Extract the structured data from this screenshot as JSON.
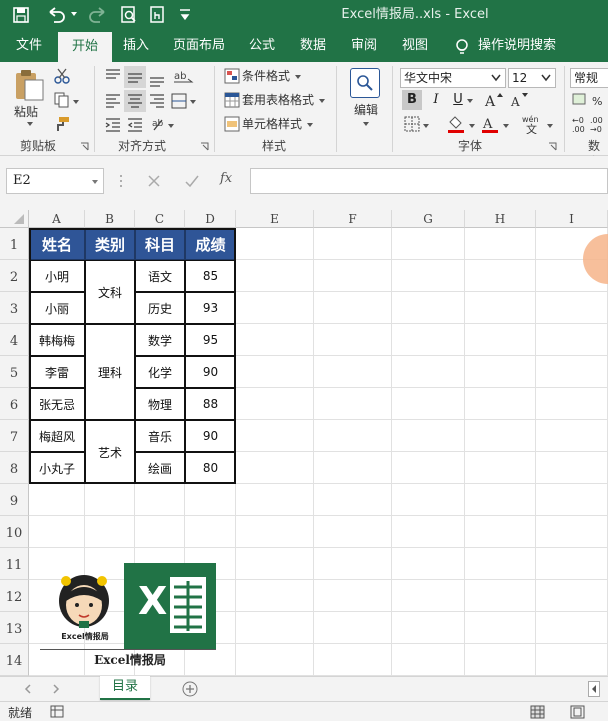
{
  "window": {
    "title": "Excel情报局..xls  -  Excel"
  },
  "quick_access": {
    "save_icon": "save-icon",
    "undo_icon": "undo-icon",
    "redo_icon": "redo-icon",
    "print_preview_icon": "print-preview-icon",
    "touch_icon": "touch-mode-icon",
    "customize_icon": "customize-icon"
  },
  "tabs": [
    {
      "label": "文件",
      "active": false
    },
    {
      "label": "开始",
      "active": true
    },
    {
      "label": "插入",
      "active": false
    },
    {
      "label": "页面布局",
      "active": false
    },
    {
      "label": "公式",
      "active": false
    },
    {
      "label": "数据",
      "active": false
    },
    {
      "label": "审阅",
      "active": false
    },
    {
      "label": "视图",
      "active": false
    }
  ],
  "tell_me": {
    "label": "操作说明搜索"
  },
  "ribbon": {
    "clipboard": {
      "paste_label": "粘贴",
      "group_label": "剪贴板"
    },
    "alignment": {
      "group_label": "对齐方式"
    },
    "styles": {
      "conditional_format": "条件格式",
      "table_format": "套用表格格式",
      "cell_styles": "单元格样式",
      "group_label": "样式"
    },
    "editing": {
      "label": "编辑"
    },
    "font": {
      "name": "华文中宋",
      "size": "12",
      "bold": "B",
      "italic": "I",
      "underline": "U",
      "group_label": "字体"
    },
    "number": {
      "format": "常规",
      "group_label": "数字"
    }
  },
  "formula_bar": {
    "name_box": "E2",
    "fx_label": "fx",
    "content": ""
  },
  "columns": [
    "A",
    "B",
    "C",
    "D",
    "E",
    "F",
    "G",
    "H",
    "I"
  ],
  "rows": [
    "1",
    "2",
    "3",
    "4",
    "5",
    "6",
    "7",
    "8",
    "9",
    "10",
    "11",
    "12",
    "13",
    "14"
  ],
  "table": {
    "headers": [
      "姓名",
      "类别",
      "科目",
      "成绩"
    ],
    "names": [
      "小明",
      "小丽",
      "韩梅梅",
      "李雷",
      "张无忌",
      "梅超风",
      "小丸子"
    ],
    "categories": [
      {
        "label": "文科",
        "span": 2
      },
      {
        "label": "理科",
        "span": 3
      },
      {
        "label": "艺术",
        "span": 2
      }
    ],
    "subjects": [
      "语文",
      "历史",
      "数学",
      "化学",
      "物理",
      "音乐",
      "绘画"
    ],
    "scores": [
      "85",
      "93",
      "95",
      "90",
      "88",
      "90",
      "80"
    ],
    "header_color": "#2f5597"
  },
  "watermark": {
    "text": "Excel情报局",
    "logo_caption": "Excel情报局",
    "logo_letter": "X"
  },
  "sheet_tabs": [
    {
      "label": "目录",
      "active": true
    }
  ],
  "status": {
    "ready": "就绪"
  },
  "accent": "#217346"
}
